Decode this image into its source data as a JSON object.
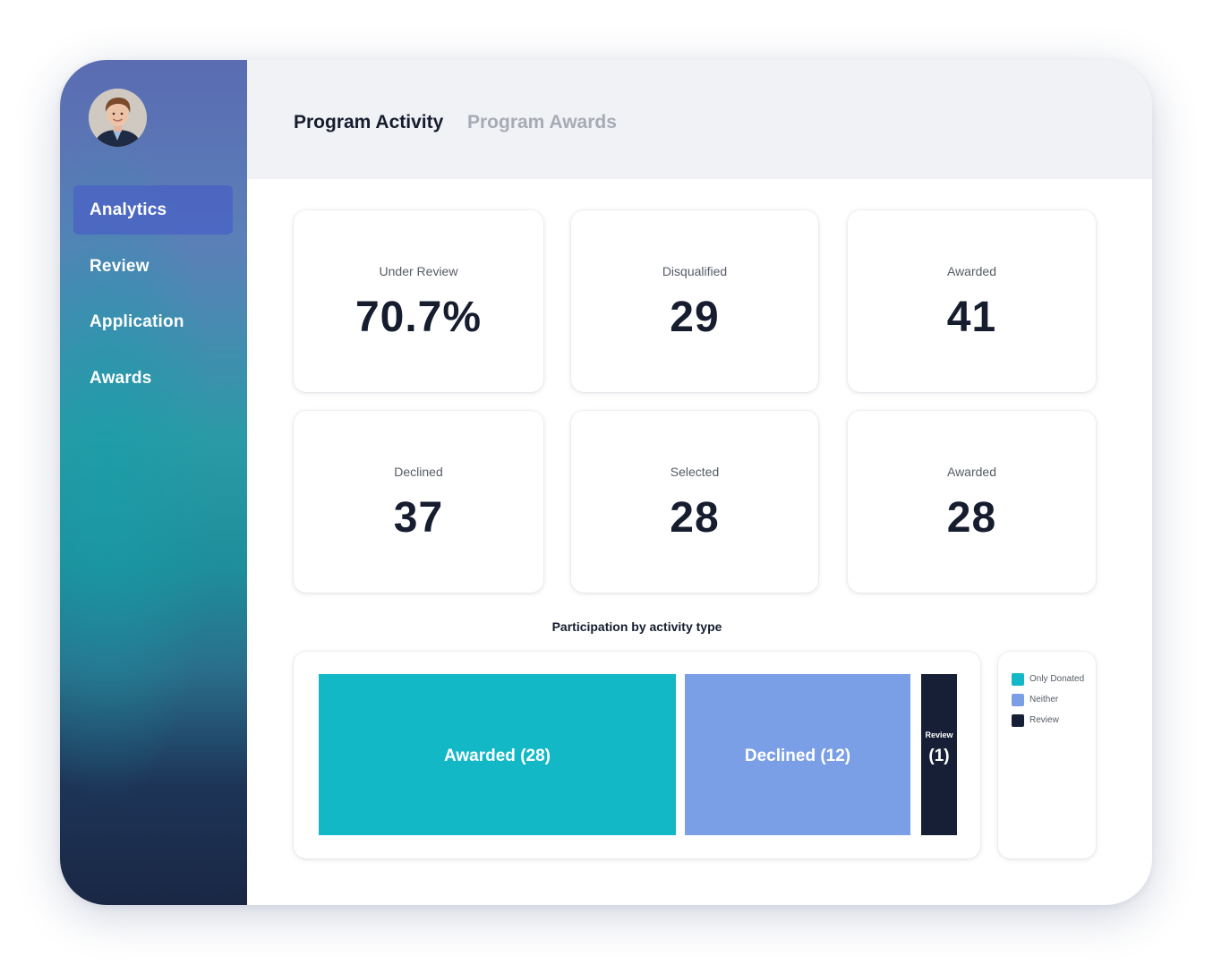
{
  "tabs": {
    "activity": "Program Activity",
    "awards": "Program Awards"
  },
  "sidebar": {
    "items": [
      {
        "label": "Analytics",
        "active": true
      },
      {
        "label": "Review",
        "active": false
      },
      {
        "label": "Application",
        "active": false
      },
      {
        "label": "Awards",
        "active": false
      }
    ]
  },
  "stats": [
    {
      "label": "Under Review",
      "value": "70.7%"
    },
    {
      "label": "Disqualified",
      "value": "29"
    },
    {
      "label": "Awarded",
      "value": "41"
    },
    {
      "label": "Declined",
      "value": "37"
    },
    {
      "label": "Selected",
      "value": "28"
    },
    {
      "label": "Awarded",
      "value": "28"
    }
  ],
  "chart_title": "Participation by activity type",
  "chart_data": {
    "type": "treemap",
    "title": "Participation by activity type",
    "segments": [
      {
        "label": "Awarded (28)",
        "value": 28,
        "color": "#12b8c6"
      },
      {
        "label": "Declined (12)",
        "value": 12,
        "color": "#7b9fe6"
      },
      {
        "label_top": "Review",
        "label_bottom": "(1)",
        "value": 1,
        "color": "#161f35"
      }
    ],
    "legend_placement": "right",
    "legend": [
      {
        "label": "Only Donated",
        "color": "#12b8c6"
      },
      {
        "label": "Neither",
        "color": "#7b9fe6"
      },
      {
        "label": "Review",
        "color": "#161f35"
      }
    ]
  },
  "colors": {
    "accent": "#12b8c6",
    "secondary": "#7b9fe6",
    "dark": "#161f35",
    "active_nav": "#4b64c3"
  }
}
